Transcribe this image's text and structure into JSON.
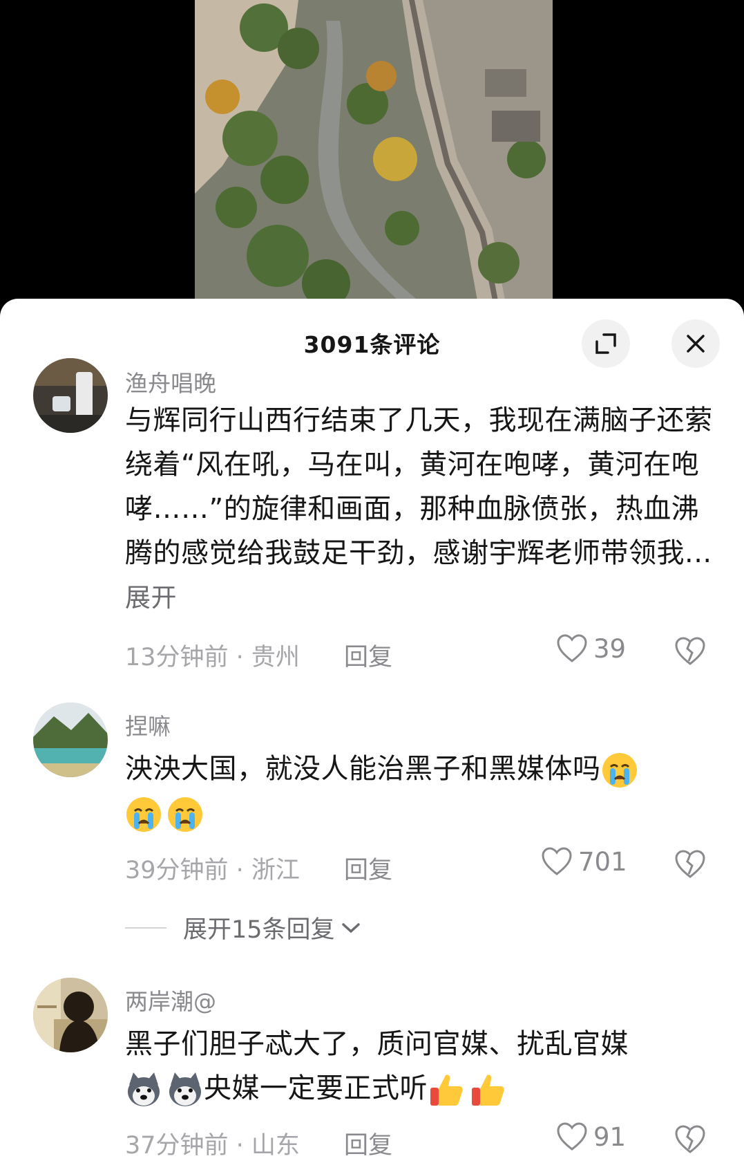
{
  "sheet": {
    "title": "3091条评论",
    "expand_icon": "fullscreen-icon",
    "close_icon": "close-icon"
  },
  "comments": [
    {
      "username": "渔舟唱晚",
      "text": "与辉同行山西行结束了几天，我现在满脑子还萦绕着“风在吼，马在叫，黄河在咆哮，黄河在咆哮……”的旋律和画面，那种血脉偾张，热血沸腾的感觉给我鼓足干劲，感谢宇辉老师带领我...",
      "more_label": "展开",
      "time_location": "13分钟前 · 贵州",
      "reply_label": "回复",
      "likes": "39"
    },
    {
      "username": "捏嘛",
      "text": "泱泱大国，就没人能治黑子和黑媒体吗",
      "emojis": [
        "crying-face-emoji",
        "crying-face-emoji",
        "crying-face-emoji"
      ],
      "time_location": "39分钟前 · 浙江",
      "reply_label": "回复",
      "likes": "701",
      "expand_replies": "展开15条回复"
    },
    {
      "username": "两岸潮@",
      "text_part1": "黑子们胆子忒大了，质问官媒、扰乱官媒",
      "text_part2": "央媒一定要正式听",
      "emojis_before": [
        "husky-dog-emoji",
        "husky-dog-emoji"
      ],
      "emojis_after": [
        "thumbs-up-emoji",
        "thumbs-up-emoji"
      ],
      "time_location": "37分钟前 · 山东",
      "reply_label": "回复",
      "likes": "91"
    }
  ],
  "colors": {
    "sheet_bg": "#ffffff",
    "primary_text": "#161616",
    "secondary_text": "#8a8a8e",
    "meta_text": "#a6a6aa"
  }
}
